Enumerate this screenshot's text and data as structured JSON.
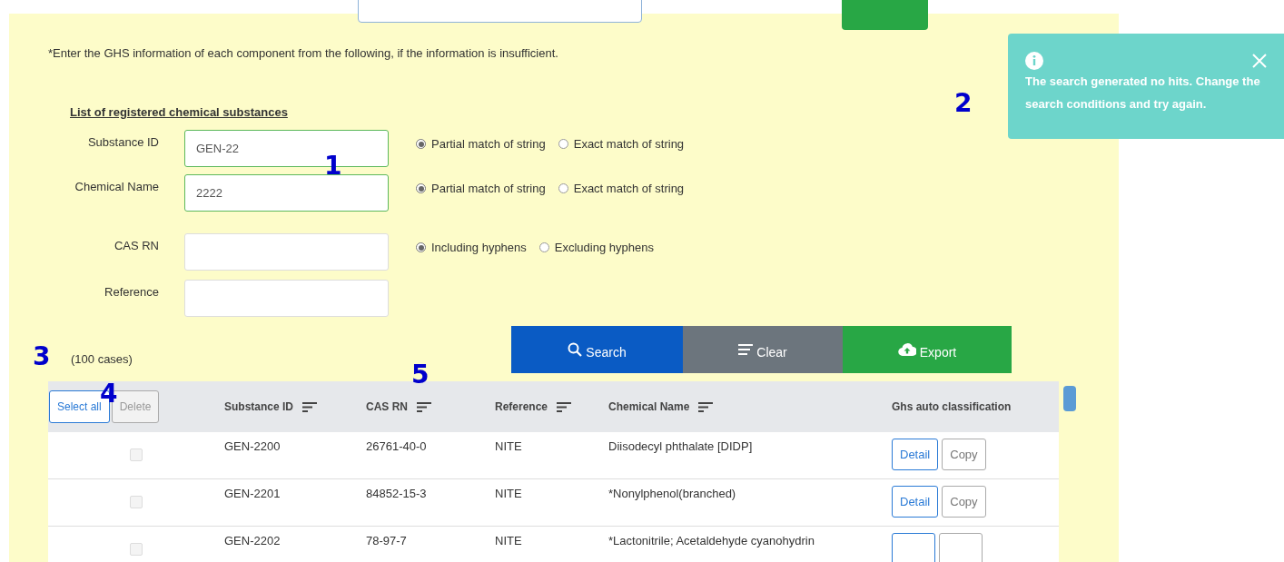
{
  "notice": "*Enter the GHS information of each component from the following, if the information is insufficient.",
  "section_title": "List of registered chemical substances",
  "form": {
    "rows": [
      {
        "label": "Substance ID",
        "value": "GEN-22",
        "focused": true,
        "options": [
          {
            "label": "Partial match of string",
            "selected": true
          },
          {
            "label": "Exact match of string",
            "selected": false
          }
        ]
      },
      {
        "label": "Chemical Name",
        "value": "2222",
        "focused": true,
        "options": [
          {
            "label": "Partial match of string",
            "selected": true
          },
          {
            "label": "Exact match of string",
            "selected": false
          }
        ]
      },
      {
        "label": "CAS RN",
        "focused": false,
        "options": [
          {
            "label": "Including hyphens",
            "selected": true
          },
          {
            "label": "Excluding hyphens",
            "selected": false
          }
        ]
      },
      {
        "label": "Reference",
        "focused": false,
        "options": []
      }
    ]
  },
  "actions": [
    {
      "label": "Search",
      "kind": "search"
    },
    {
      "label": "Clear",
      "kind": "clear"
    },
    {
      "label": "Export",
      "kind": "export"
    }
  ],
  "count": "(100 cases)",
  "table": {
    "header_buttons": [
      {
        "label": "Select all",
        "disabled": false
      },
      {
        "label": "Delete",
        "disabled": true
      }
    ],
    "columns": [
      {
        "label": "Substance ID",
        "sortable": true
      },
      {
        "label": "CAS RN",
        "sortable": true
      },
      {
        "label": "Reference",
        "sortable": true
      },
      {
        "label": "Chemical Name",
        "sortable": true
      },
      {
        "label": "Ghs auto classification",
        "sortable": false
      }
    ],
    "rows": [
      {
        "checked": false,
        "cells": [
          "GEN-2200",
          "26761-40-0",
          "NITE",
          "Diisodecyl phthalate [DIDP]"
        ],
        "buttons": [
          {
            "label": "Detail",
            "kind": "primary"
          },
          {
            "label": "Copy",
            "kind": "secondary"
          }
        ]
      },
      {
        "checked": false,
        "cells": [
          "GEN-2201",
          "84852-15-3",
          "NITE",
          "*Nonylphenol(branched)"
        ],
        "buttons": [
          {
            "label": "Detail",
            "kind": "primary"
          },
          {
            "label": "Copy",
            "kind": "secondary"
          }
        ]
      },
      {
        "checked": false,
        "cells": [
          "GEN-2202",
          "78-97-7",
          "NITE",
          "*Lactonitrile; Acetaldehyde cyanohydrin"
        ],
        "buttons": [
          {
            "kind": "primary"
          },
          {
            "kind": "secondary"
          }
        ]
      }
    ]
  },
  "toast": {
    "kind": "info",
    "message": "The search generated no hits. Change the search conditions and try again."
  },
  "annotations": [
    "1",
    "2",
    "3",
    "4",
    "5"
  ]
}
